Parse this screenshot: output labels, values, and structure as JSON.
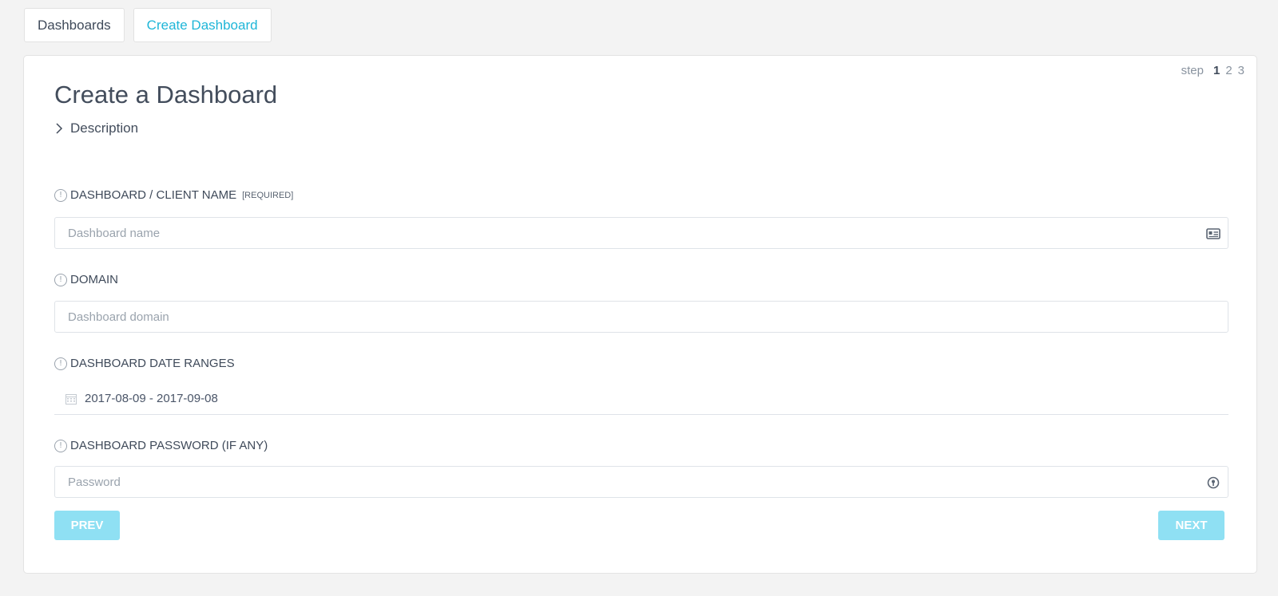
{
  "tabs": [
    {
      "label": "Dashboards",
      "active": false
    },
    {
      "label": "Create Dashboard",
      "active": true
    }
  ],
  "stepper": {
    "label": "step",
    "steps": [
      "1",
      "2",
      "3"
    ],
    "current": "1"
  },
  "page_title": "Create a Dashboard",
  "description_toggle": "Description",
  "fields": {
    "name": {
      "label": "DASHBOARD / CLIENT NAME",
      "required": "[REQUIRED]",
      "placeholder": "Dashboard name",
      "value": "",
      "icon": "id-card-icon"
    },
    "domain": {
      "label": "DOMAIN",
      "placeholder": "Dashboard domain",
      "value": ""
    },
    "date_ranges": {
      "label": "DASHBOARD DATE RANGES",
      "value": "2017-08-09 - 2017-09-08",
      "icon": "calendar-icon"
    },
    "password": {
      "label": "DASHBOARD PASSWORD (IF ANY)",
      "placeholder": "Password",
      "value": "",
      "icon": "key-icon"
    }
  },
  "buttons": {
    "prev": "PREV",
    "next": "NEXT"
  },
  "colors": {
    "accent": "#1fb6d8",
    "button_bg": "#8fe0f3",
    "text": "#434d5c"
  }
}
